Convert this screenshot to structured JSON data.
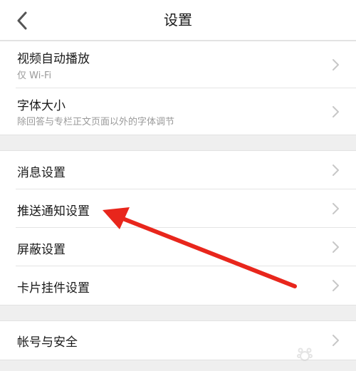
{
  "header": {
    "title": "设置"
  },
  "groups": [
    {
      "items": [
        {
          "label": "视频自动播放",
          "sub": "仅 Wi-Fi"
        },
        {
          "label": "字体大小",
          "sub": "除回答与专栏正文页面以外的字体调节"
        }
      ]
    },
    {
      "items": [
        {
          "label": "消息设置"
        },
        {
          "label": "推送通知设置"
        },
        {
          "label": "屏蔽设置"
        },
        {
          "label": "卡片挂件设置"
        }
      ]
    },
    {
      "items": [
        {
          "label": "帐号与安全"
        }
      ]
    }
  ],
  "icons": {
    "back": "chevron-left-icon",
    "row": "chevron-right-icon"
  },
  "colors": {
    "annotation_arrow": "#e8261c",
    "chevron": "#c7c7c7",
    "background": "#efefef"
  }
}
